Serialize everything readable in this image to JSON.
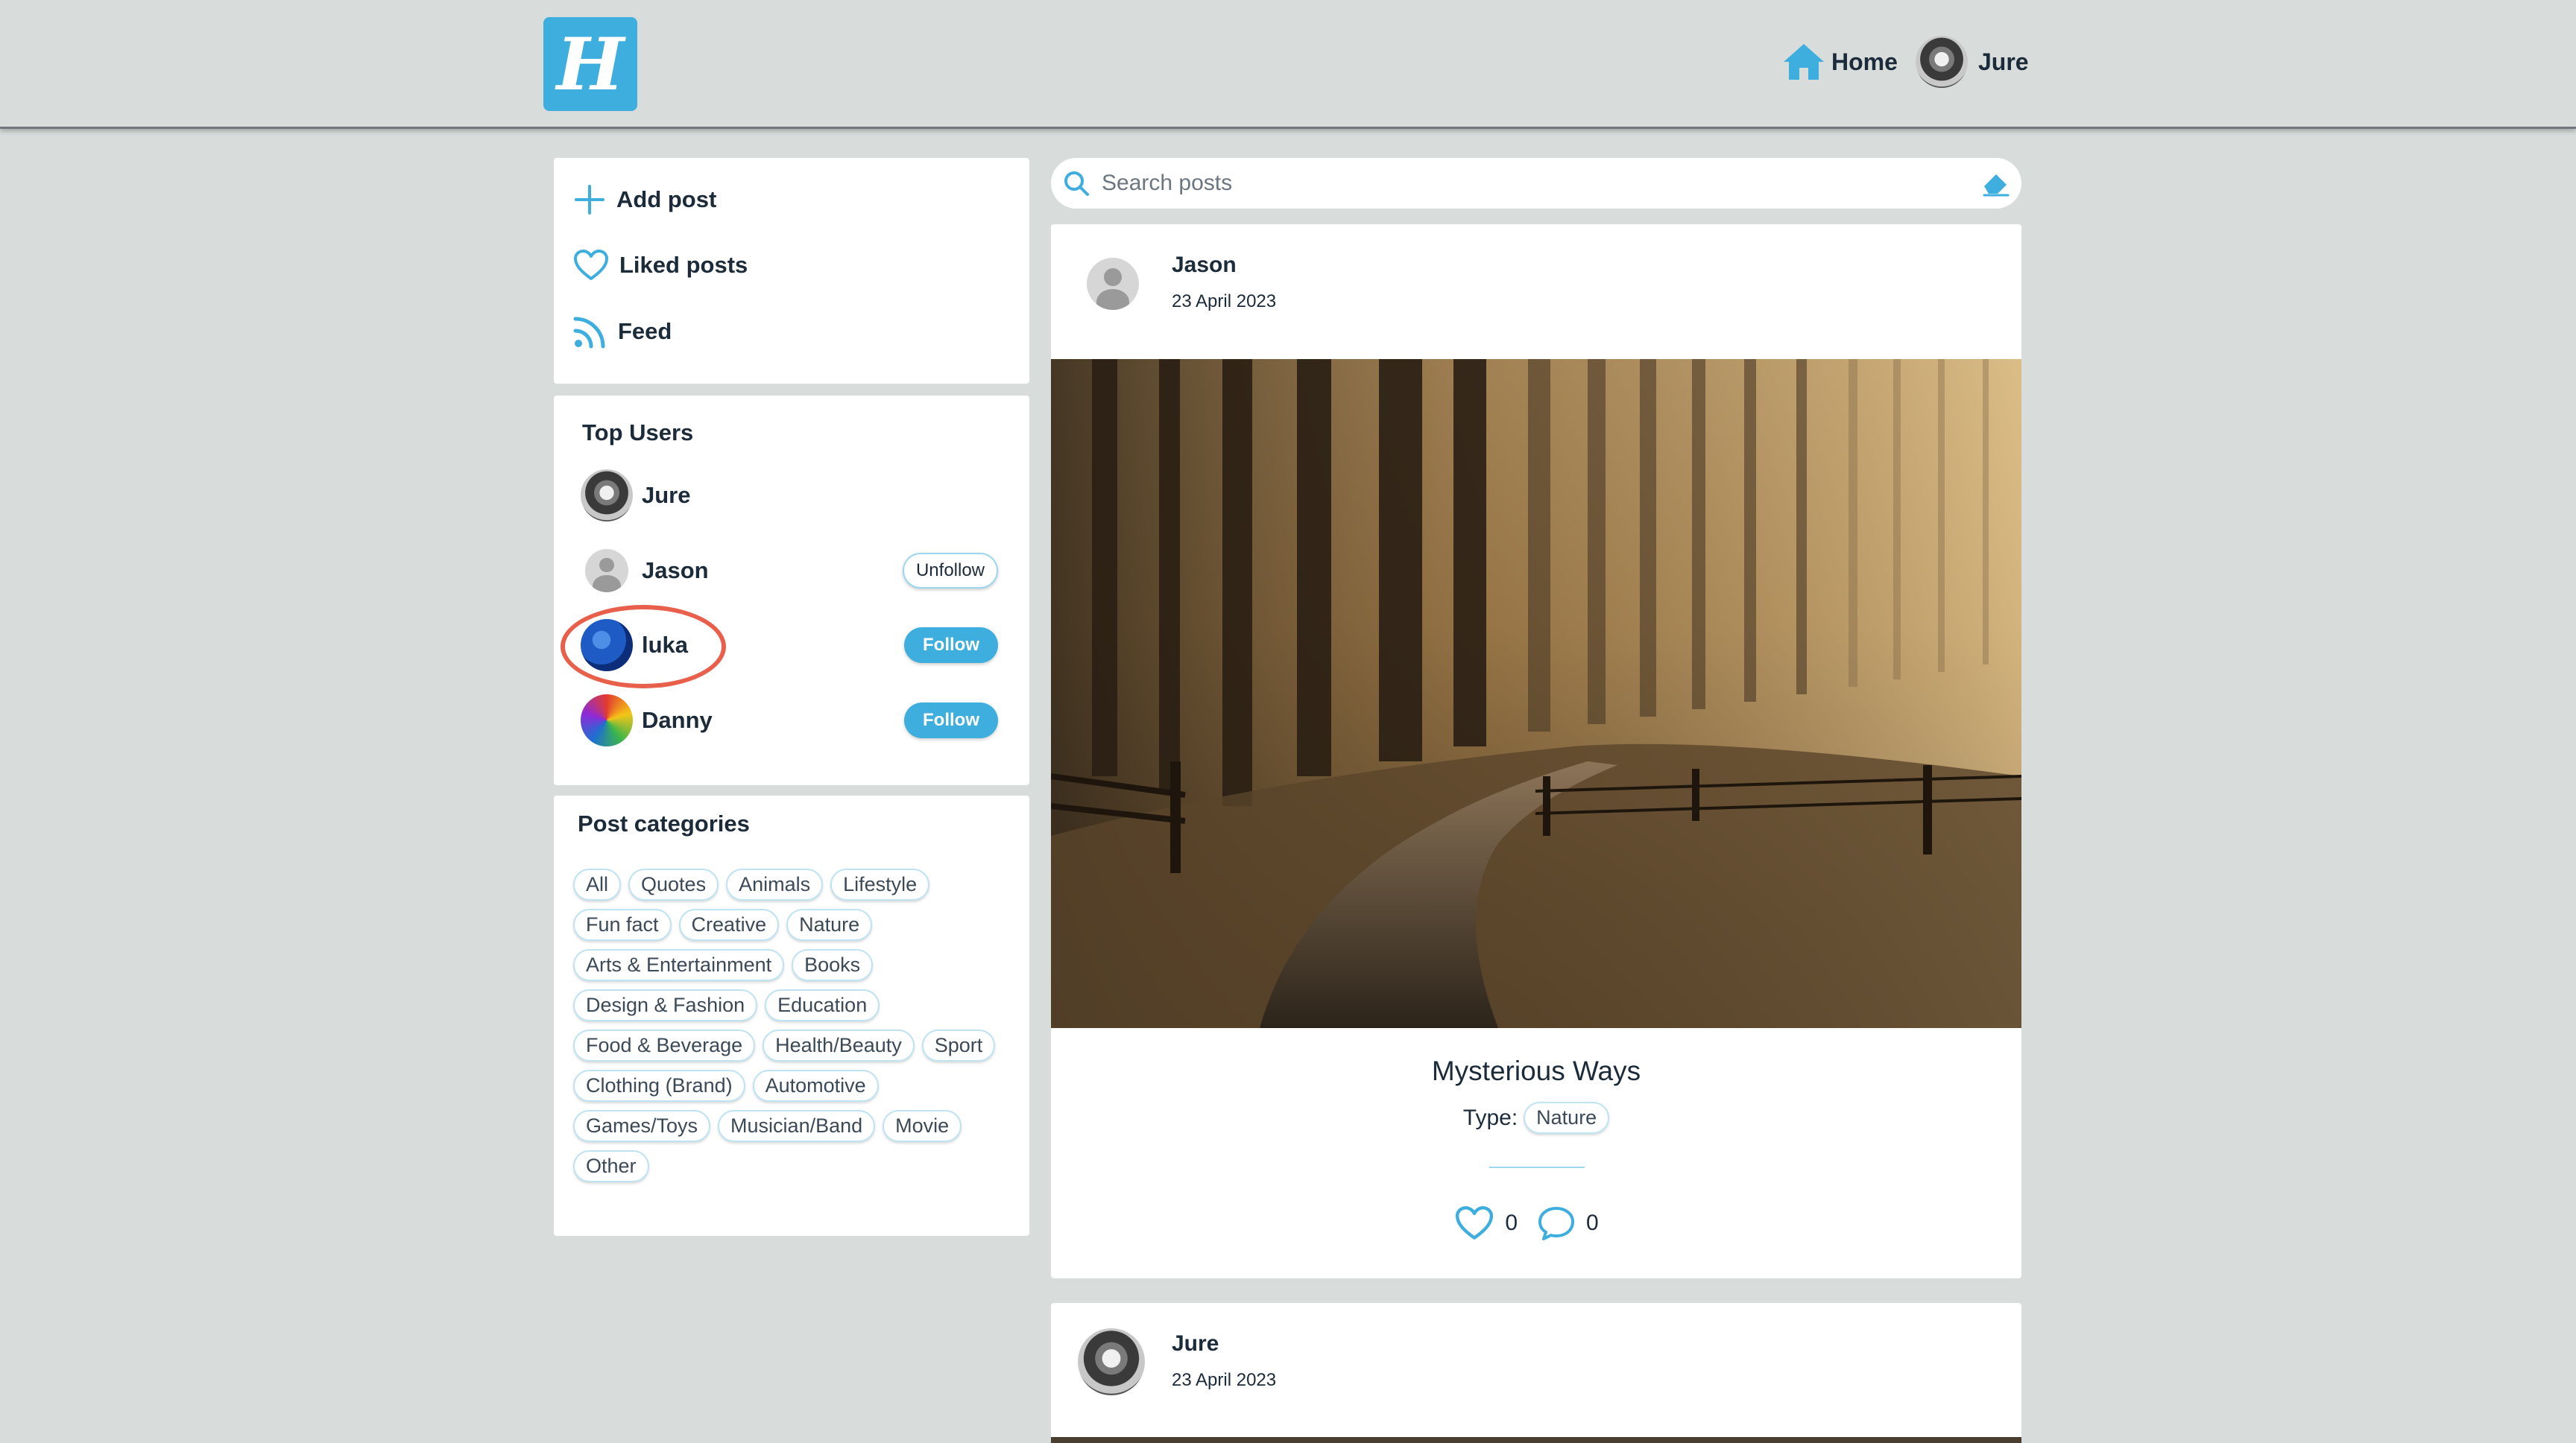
{
  "header": {
    "logo_letter": "H",
    "home_label": "Home",
    "user_name": "Jure"
  },
  "sidebar": {
    "menu": [
      {
        "label": "Add post",
        "icon": "plus-icon"
      },
      {
        "label": "Liked posts",
        "icon": "heart-icon"
      },
      {
        "label": "Feed",
        "icon": "rss-icon"
      }
    ],
    "top_users": {
      "title": "Top Users",
      "users": [
        {
          "name": "Jure",
          "button": ""
        },
        {
          "name": "Jason",
          "button": "Unfollow"
        },
        {
          "name": "luka",
          "button": "Follow"
        },
        {
          "name": "Danny",
          "button": "Follow"
        }
      ]
    },
    "categories": {
      "title": "Post categories",
      "items": [
        "All",
        "Quotes",
        "Animals",
        "Lifestyle",
        "Fun fact",
        "Creative",
        "Nature",
        "Arts & Entertainment",
        "Books",
        "Design & Fashion",
        "Education",
        "Food & Beverage",
        "Health/Beauty",
        "Sport",
        "Clothing (Brand)",
        "Automotive",
        "Games/Toys",
        "Musician/Band",
        "Movie",
        "Other"
      ]
    }
  },
  "search": {
    "placeholder": "Search posts",
    "value": ""
  },
  "posts": [
    {
      "author": "Jason",
      "date": "23 April 2023",
      "title": "Mysterious Ways",
      "type_label": "Type:",
      "type": "Nature",
      "likes": "0",
      "comments": "0"
    },
    {
      "author": "Jure",
      "date": "23 April 2023"
    }
  ],
  "colors": {
    "accent": "#3eaede",
    "background": "#d8dddc",
    "highlight": "#e8604c"
  }
}
